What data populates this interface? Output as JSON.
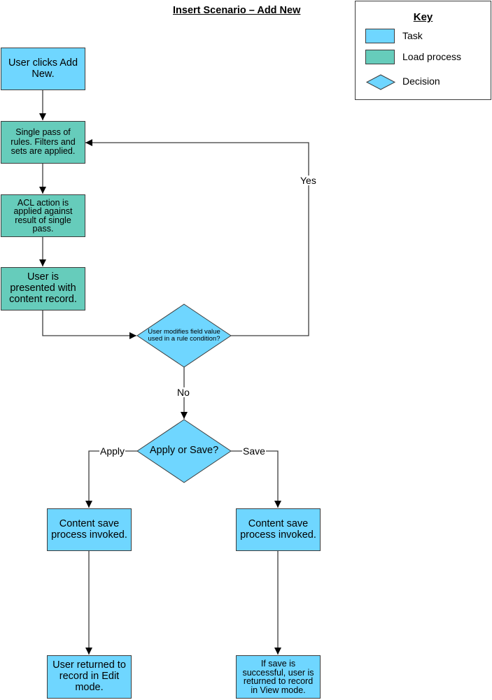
{
  "title": "Insert Scenario – Add New",
  "key": {
    "title": "Key",
    "items": [
      {
        "shape": "rectangle",
        "label": "Task",
        "color": "#6fd6ff"
      },
      {
        "shape": "rectangle",
        "label": "Load process",
        "color": "#66ccbb"
      },
      {
        "shape": "diamond",
        "label": "Decision",
        "color": "#6fd6ff"
      }
    ]
  },
  "nodes": {
    "add_new": {
      "type": "task",
      "text": "User clicks Add New."
    },
    "single_pass": {
      "type": "load",
      "text": "Single pass of rules. Filters and sets are applied."
    },
    "acl_action": {
      "type": "load",
      "text": "ACL action is applied against result of single pass."
    },
    "presented": {
      "type": "load",
      "text": "User is presented with content record."
    },
    "modifies_decision": {
      "type": "decision",
      "text": "User modifies field value used in a rule condition?"
    },
    "apply_or_save": {
      "type": "decision",
      "text": "Apply or Save?"
    },
    "save_left": {
      "type": "task",
      "text": "Content save process invoked."
    },
    "save_right": {
      "type": "task",
      "text": "Content save process invoked."
    },
    "edit_mode": {
      "type": "task",
      "text": "User returned to record in Edit mode."
    },
    "view_mode": {
      "type": "task",
      "text": "If save is successful, user is returned to record in View mode."
    }
  },
  "edges": [
    {
      "from": "add_new",
      "to": "single_pass",
      "label": ""
    },
    {
      "from": "single_pass",
      "to": "acl_action",
      "label": ""
    },
    {
      "from": "acl_action",
      "to": "presented",
      "label": ""
    },
    {
      "from": "presented",
      "to": "modifies_decision",
      "label": ""
    },
    {
      "from": "modifies_decision",
      "to": "single_pass",
      "label": "Yes"
    },
    {
      "from": "modifies_decision",
      "to": "apply_or_save",
      "label": "No"
    },
    {
      "from": "apply_or_save",
      "to": "save_left",
      "label": "Apply"
    },
    {
      "from": "apply_or_save",
      "to": "save_right",
      "label": "Save"
    },
    {
      "from": "save_left",
      "to": "edit_mode",
      "label": ""
    },
    {
      "from": "save_right",
      "to": "view_mode",
      "label": ""
    }
  ],
  "edge_labels": {
    "yes": "Yes",
    "no": "No",
    "apply": "Apply",
    "save": "Save"
  },
  "colors": {
    "task": "#6fd6ff",
    "load": "#66ccbb",
    "decision": "#6fd6ff",
    "line": "#3c3c3c"
  }
}
